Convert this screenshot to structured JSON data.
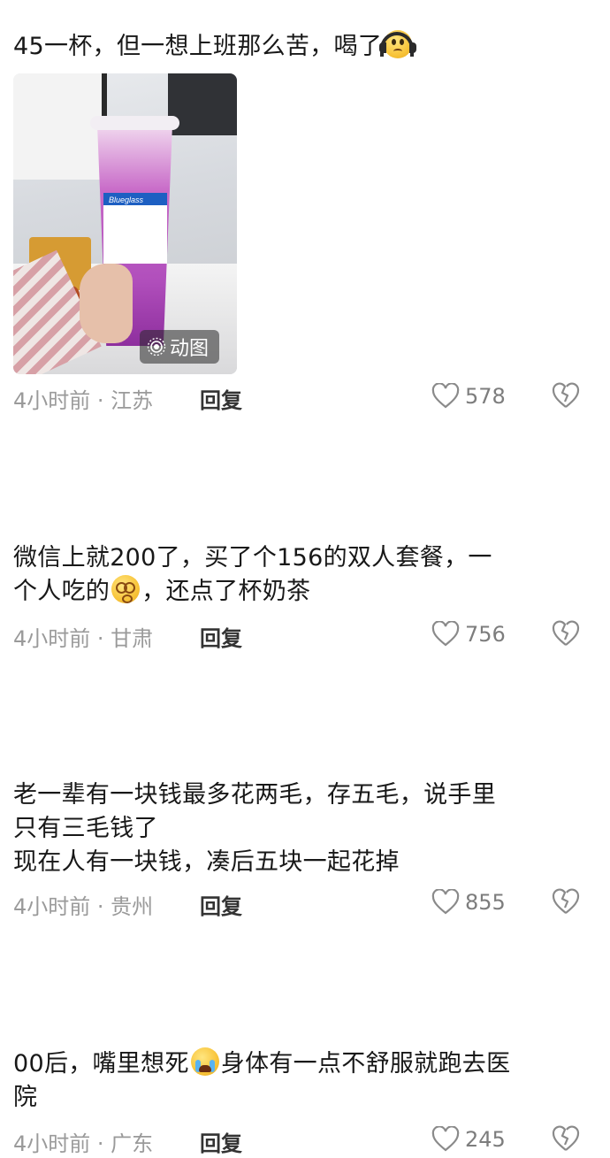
{
  "comments": [
    {
      "text_lines": [
        "45一杯，但一想上班那么苦，喝了"
      ],
      "emoji": "headphone-face",
      "media": {
        "cup_brand": "Blueglass",
        "badge_label": "动图"
      },
      "time_location": "4小时前 · 江苏",
      "reply_label": "回复",
      "likes": "578"
    },
    {
      "text_lines": [
        "微信上就200了，买了个156的双人套餐，一",
        "个人吃的",
        "，还点了杯奶茶"
      ],
      "emoji": "dizzy-face",
      "time_location": "4小时前 · 甘肃",
      "reply_label": "回复",
      "likes": "756"
    },
    {
      "text_lines": [
        "老一辈有一块钱最多花两毛，存五毛，说手里",
        "只有三毛钱了",
        "现在人有一块钱，凑后五块一起花掉"
      ],
      "time_location": "4小时前 · 贵州",
      "reply_label": "回复",
      "likes": "855"
    },
    {
      "text_lines": [
        "00后，嘴里想死",
        "身体有一点不舒服就跑去医",
        "院"
      ],
      "emoji": "loudly-crying-face",
      "time_location": "4小时前 · 广东",
      "reply_label": "回复",
      "likes": "245"
    }
  ],
  "colors": {
    "text": "#181818",
    "meta": "#9a9a9a",
    "reply": "#333333",
    "icon": "#8a8a8a"
  }
}
